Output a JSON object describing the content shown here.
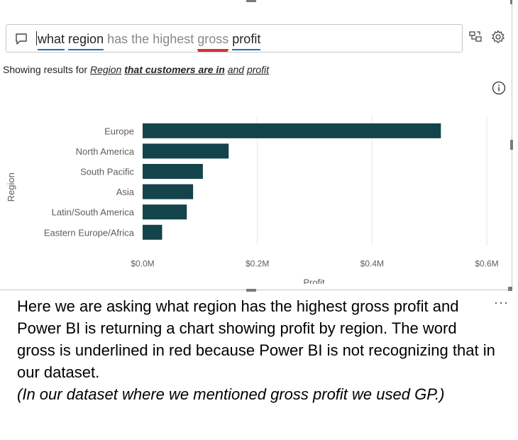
{
  "qa": {
    "words": [
      {
        "text": "what",
        "state": "recognized"
      },
      {
        "text": "region",
        "state": "recognized"
      },
      {
        "text": "has",
        "state": "dim"
      },
      {
        "text": "the",
        "state": "dim"
      },
      {
        "text": "highest",
        "state": "dim"
      },
      {
        "text": "gross",
        "state": "unrecognized"
      },
      {
        "text": "profit",
        "state": "recognized"
      }
    ]
  },
  "showing": {
    "prefix": "Showing results for ",
    "part1": "Region",
    "part2": "that customers are in",
    "part3": "and",
    "part4": "profit"
  },
  "chart_data": {
    "type": "bar",
    "orientation": "horizontal",
    "categories": [
      "Europe",
      "North America",
      "South Pacific",
      "Asia",
      "Latin/South America",
      "Eastern Europe/Africa"
    ],
    "values": [
      0.52,
      0.15,
      0.105,
      0.088,
      0.077,
      0.034
    ],
    "xlabel": "Profit",
    "ylabel": "Region",
    "xlim": [
      0,
      0.6
    ],
    "xticks": [
      0,
      0.2,
      0.4,
      0.6
    ],
    "xtick_labels": [
      "$0.0M",
      "$0.2M",
      "$0.4M",
      "$0.6M"
    ],
    "bar_color": "#13434b",
    "grid": true
  },
  "caption": {
    "line1": "Here we are asking what region has the highest gross profit and Power BI is returning a chart showing profit by region. The word gross is underlined in red because Power BI is not recognizing that in our dataset.",
    "line2": "(In our dataset where we mentioned gross profit we used GP.)"
  },
  "ellipsis": "···",
  "icons": {
    "chat": "chat-bubble-icon",
    "convert": "turn-into-visual-icon",
    "settings": "gear-icon",
    "info": "info-icon"
  }
}
